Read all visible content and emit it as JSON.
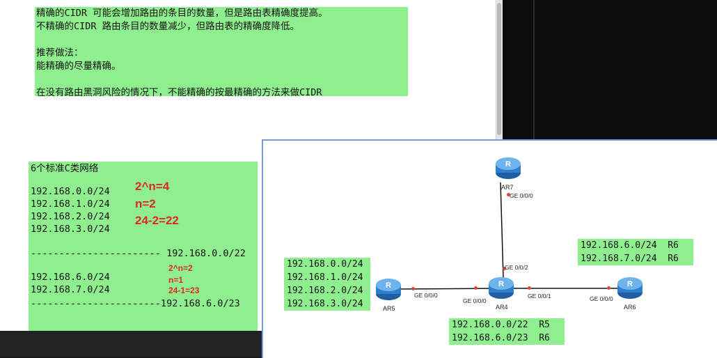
{
  "note": {
    "lines": [
      "精确的CIDR 可能会增加路由的条目的数量，但是路由表精确度提高。",
      "不精确的CIDR 路由条目的数量减少，但路由表的精确度降低。",
      "",
      "推荐做法：",
      "能精确的尽量精确。",
      "",
      "在没有路由黑洞风险的情况下，不能精确的按最精确的方法来做CIDR"
    ]
  },
  "subnet": {
    "heading": "6个标准C类网络",
    "group1": [
      "192.168.0.0/24",
      "192.168.1.0/24",
      "192.168.2.0/24",
      "192.168.3.0/24"
    ],
    "summary1": "----------------------- 192.168.0.0/22",
    "group2": [
      "192.168.6.0/24",
      "192.168.7.0/24"
    ],
    "summary2": "-----------------------192.168.6.0/23",
    "calc1": [
      "2^n=4",
      "n=2",
      "24-2=22"
    ],
    "calc2": [
      "2^n=2",
      "n=1",
      "24-1=23"
    ]
  },
  "topology": {
    "routers": {
      "ar7": "AR7",
      "ar5": "AR5",
      "ar4": "AR4",
      "ar6": "AR6",
      "glyph": "R"
    },
    "ports": {
      "ar7_g0": "GE 0/0/0",
      "ar4_g2": "GE 0/0/2",
      "ar5_g0": "GE 0/0/0",
      "ar4_g0": "GE 0/0/0",
      "ar4_g1": "GE 0/0/1",
      "ar6_g0": "GE 0/0/0"
    },
    "ar5_nets": [
      "192.168.0.0/24",
      "192.168.1.0/24",
      "192.168.2.0/24",
      "192.168.3.0/24"
    ],
    "ar6_nets": [
      "192.168.6.0/24  R6",
      "192.168.7.0/24  R6"
    ],
    "ar4_routes": [
      "192.168.0.0/22  R5",
      "192.168.6.0/23  R6"
    ]
  },
  "colors": {
    "highlight_green": "#8fef8f",
    "annotation_red": "#e0262b",
    "link_dot": "#e2433f",
    "router_blue": "#2f7fcf"
  }
}
